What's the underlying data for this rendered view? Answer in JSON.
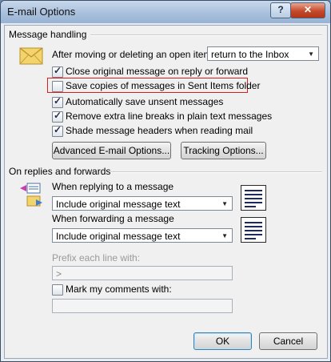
{
  "window": {
    "title": "E-mail Options",
    "help_label": "?",
    "close_label": "✕"
  },
  "message_handling": {
    "group_title": "Message handling",
    "after_label": "After moving or deleting an open item:",
    "after_value": "return to the Inbox",
    "options": [
      {
        "label": "Close original message on reply or forward",
        "checked": true
      },
      {
        "label": "Save copies of messages in Sent Items folder",
        "checked": false
      },
      {
        "label": "Automatically save unsent messages",
        "checked": true
      },
      {
        "label": "Remove extra line breaks in plain text messages",
        "checked": true
      },
      {
        "label": "Shade message headers when reading mail",
        "checked": true
      }
    ],
    "advanced_button": "Advanced E-mail Options...",
    "tracking_button": "Tracking Options..."
  },
  "replies": {
    "group_title": "On replies and forwards",
    "reply_label": "When replying to a message",
    "reply_value": "Include original message text",
    "forward_label": "When forwarding a message",
    "forward_value": "Include original message text",
    "prefix_label": "Prefix each line with:",
    "prefix_value": ">",
    "mark_label": "Mark my comments with:",
    "mark_checked": false,
    "mark_value": ""
  },
  "buttons": {
    "ok": "OK",
    "cancel": "Cancel"
  },
  "colors": {
    "highlight": "#d62020",
    "title_gradient_top": "#c8d8ea",
    "close_button": "#c4492a"
  },
  "icons": [
    "envelope-icon",
    "reply-forward-icon",
    "reply-preview-icon",
    "forward-preview-icon",
    "dropdown-arrow-icon",
    "checkmark-icon",
    "help-icon",
    "close-icon"
  ]
}
